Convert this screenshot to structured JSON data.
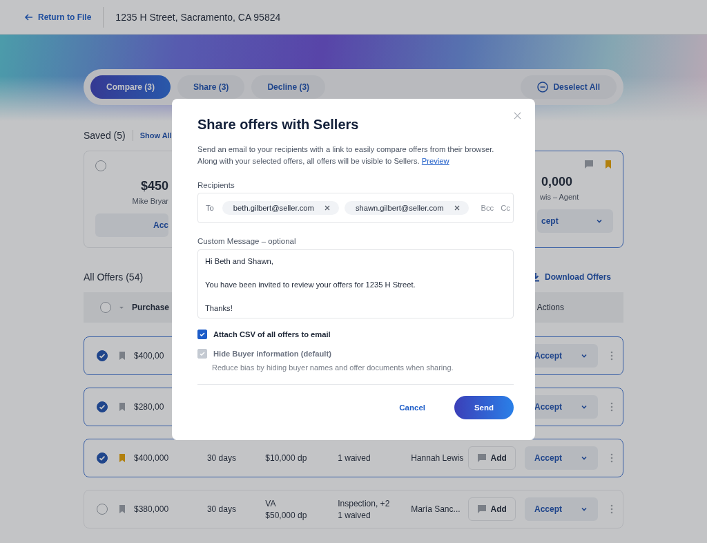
{
  "header": {
    "back_link": "Return to File",
    "address": "1235 H Street, Sacramento, CA 95824"
  },
  "action_bar": {
    "tabs": [
      {
        "label": "Compare (3)",
        "selected": true
      },
      {
        "label": "Share (3)",
        "selected": false
      },
      {
        "label": "Decline (3)",
        "selected": false
      }
    ],
    "deselect_all": "Deselect All"
  },
  "saved": {
    "title": "Saved (5)",
    "show_all": "Show All",
    "left_card": {
      "selected": false,
      "price": "$450",
      "name": "Mike Bryar",
      "accept": "Acc"
    },
    "right_card": {
      "bookmarked": true,
      "price": "0,000",
      "name": "wis – Agent",
      "accept": "cept"
    }
  },
  "all_offers": {
    "title": "All Offers (54)",
    "download": "Download Offers",
    "header_checked": false,
    "columns": [
      "Purchase",
      "Actions"
    ],
    "rows": [
      {
        "selected": true,
        "bookmarked": false,
        "price": "$400,00",
        "accept": "Accept"
      },
      {
        "selected": true,
        "bookmarked": false,
        "price": "$280,00",
        "accept": "Accept"
      },
      {
        "selected": true,
        "bookmarked": true,
        "price": "$400,000",
        "closing": "30 days",
        "financing": [
          "$10,000 dp"
        ],
        "contingencies": [
          "1 waived"
        ],
        "agent": "Hannah Lewis",
        "note": "Add",
        "accept": "Accept"
      },
      {
        "selected": false,
        "bookmarked": false,
        "price": "$380,000",
        "closing": "30 days",
        "financing": [
          "VA",
          "$50,000 dp"
        ],
        "contingencies": [
          "Inspection, +2",
          "1 waived"
        ],
        "agent": "María Sanc...",
        "note": "Add",
        "accept": "Accept"
      }
    ]
  },
  "modal": {
    "title": "Share offers with Sellers",
    "description": "Send an email to your recipients with a link to easily compare offers from their browser. Along with your selected offers, all offers will be visible to Sellers.",
    "preview_link": "Preview",
    "recipients_label": "Recipients",
    "to_label": "To",
    "recipients": [
      "beth.gilbert@seller.com",
      "shawn.gilbert@seller.com"
    ],
    "bcc": "Bcc",
    "cc": "Cc",
    "message_label": "Custom Message – optional",
    "message": "Hi Beth and Shawn,\n\nYou have been invited to review your offers for 1235 H Street.\n\nThanks!",
    "options": [
      {
        "label": "Attach CSV of all offers to email",
        "checked": true,
        "disabled": false
      },
      {
        "label": "Hide Buyer information (default)",
        "checked": true,
        "disabled": true,
        "help": "Reduce bias by hiding buyer names and offer documents when sharing."
      }
    ],
    "cancel": "Cancel",
    "send": "Send"
  }
}
